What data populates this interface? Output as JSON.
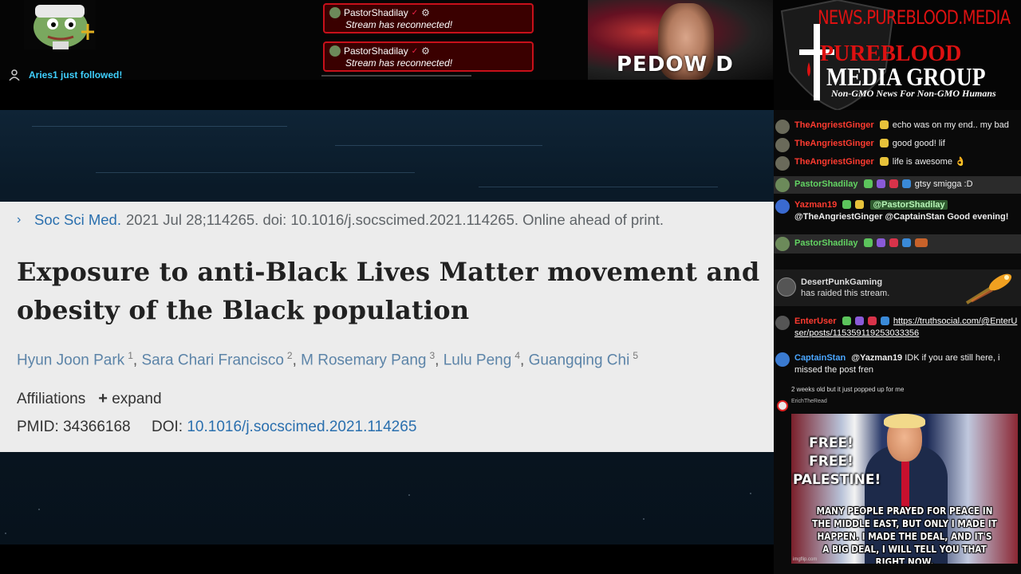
{
  "alerts": {
    "follow_text": "Aries1 just followed!",
    "reconnect": [
      {
        "user": "PastorShadilay",
        "message": "Stream has reconnected!"
      },
      {
        "user": "PastorShadilay",
        "message": "Stream has reconnected!"
      }
    ]
  },
  "camera": {
    "caption": "PEDOW   D"
  },
  "logo": {
    "site": "NEWS.PUREBLOOD.MEDIA",
    "title_top": "PUREBLOOD",
    "title_bottom": "MEDIA GROUP",
    "tagline": "Non-GMO News For Non-GMO Humans"
  },
  "article": {
    "journal": "Soc Sci Med.",
    "citation_rest": "2021 Jul 28;114265. doi: 10.1016/j.socscimed.2021.114265. Online ahead of print.",
    "title_line1": "Exposure to anti-Black Lives Matter movement and",
    "title_line2": "obesity of the Black population",
    "authors": [
      {
        "name": "Hyun Joon Park",
        "sup": "1"
      },
      {
        "name": "Sara Chari Francisco",
        "sup": "2"
      },
      {
        "name": "M Rosemary Pang",
        "sup": "3"
      },
      {
        "name": "Lulu Peng",
        "sup": "4"
      },
      {
        "name": "Guangqing Chi",
        "sup": "5"
      }
    ],
    "author_sep": ",",
    "affiliations_label": "Affiliations",
    "expand_label": "expand",
    "pmid_label": "PMID:",
    "pmid": "34366168",
    "doi_label": "DOI:",
    "doi": "10.1016/j.socscimed.2021.114265"
  },
  "chat": {
    "messages": [
      {
        "user": "TheAngriestGinger",
        "text": "echo was on my end.. my bad"
      },
      {
        "user": "TheAngriestGinger",
        "text": "good good! lif"
      },
      {
        "user": "TheAngriestGinger",
        "text": "life is awesome 👌"
      },
      {
        "user": "PastorShadilay",
        "text": "gtsy smigga :D"
      },
      {
        "user": "Yazman19",
        "mention": "@PastorShadilay",
        "text": "@TheAngriestGinger @CaptainStan Good evening!"
      },
      {
        "user": "PastorShadilay",
        "text": ""
      },
      {
        "user": "EnterUser",
        "link": "https://truthsocial.com/@EnterUser/posts/115359119253033356"
      },
      {
        "user": "CaptainStan",
        "mention": "@Yazman19",
        "text": "IDK if you are still here, i missed the post fren"
      }
    ],
    "raid": {
      "user": "DesertPunkGaming",
      "text": "has raided this stream."
    },
    "small_note": "2 weeks old but it just popped up for me",
    "small_user": "ErichTheRead",
    "meme": {
      "left_text_1": "FREE!",
      "left_text_2": "FREE!",
      "left_text_3": "PALESTINE!",
      "bottom_1": "MANY PEOPLE PRAYED FOR PEACE IN",
      "bottom_2": "THE MIDDLE EAST, BUT ONLY I MADE IT",
      "bottom_3": "HAPPEN. I MADE THE DEAL, AND IT'S",
      "bottom_4": "A BIG DEAL, I WILL TELL YOU THAT RIGHT NOW.",
      "watermark": "imgflip.com"
    }
  },
  "colors": {
    "name_red": "#ff3b30",
    "name_green": "#63d463",
    "name_blue": "#4aa6ff",
    "alert_red": "#c8101a",
    "link_blue": "#2a6fae"
  },
  "icons": {
    "verified": "verified-check-icon",
    "settings": "gear-icon",
    "chevron": "chevron-right-icon",
    "plus": "plus-icon",
    "rocket": "rocket-icon"
  }
}
